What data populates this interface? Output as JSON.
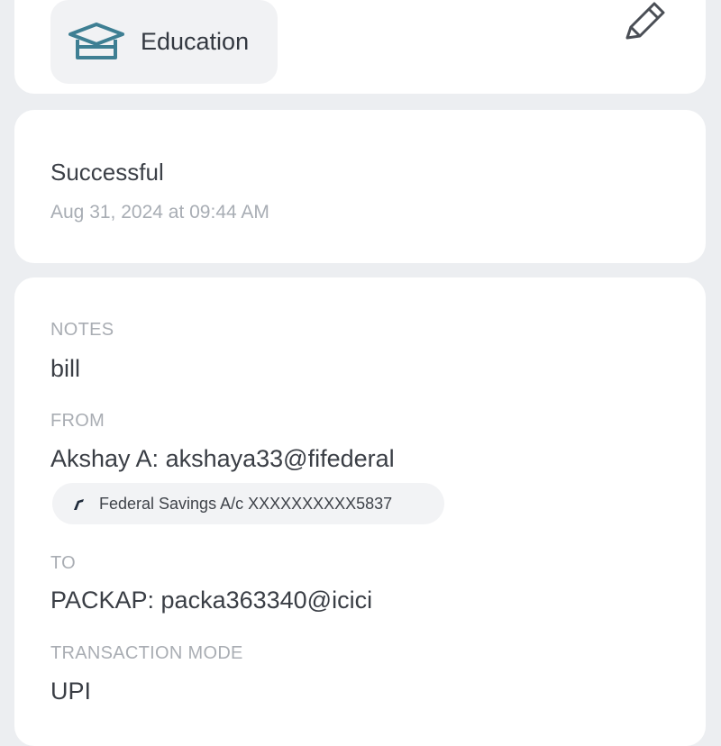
{
  "category": {
    "label": "Education",
    "icon": "education-box-icon",
    "edit_icon": "pencil-icon",
    "icon_color": "#3e7f93"
  },
  "status": {
    "text": "Successful",
    "timestamp": "Aug 31, 2024 at 09:44 AM"
  },
  "details": {
    "notes_label": "NOTES",
    "notes_value": "bill",
    "from_label": "FROM",
    "from_value": "Akshay A: akshaya33@fifederal",
    "from_account": "Federal Savings A/c XXXXXXXXXX5837",
    "from_account_icon": "federal-bank-logo-icon",
    "to_label": "TO",
    "to_value": "PACKAP: packa363340@icici",
    "mode_label": "TRANSACTION MODE",
    "mode_value": "UPI"
  }
}
